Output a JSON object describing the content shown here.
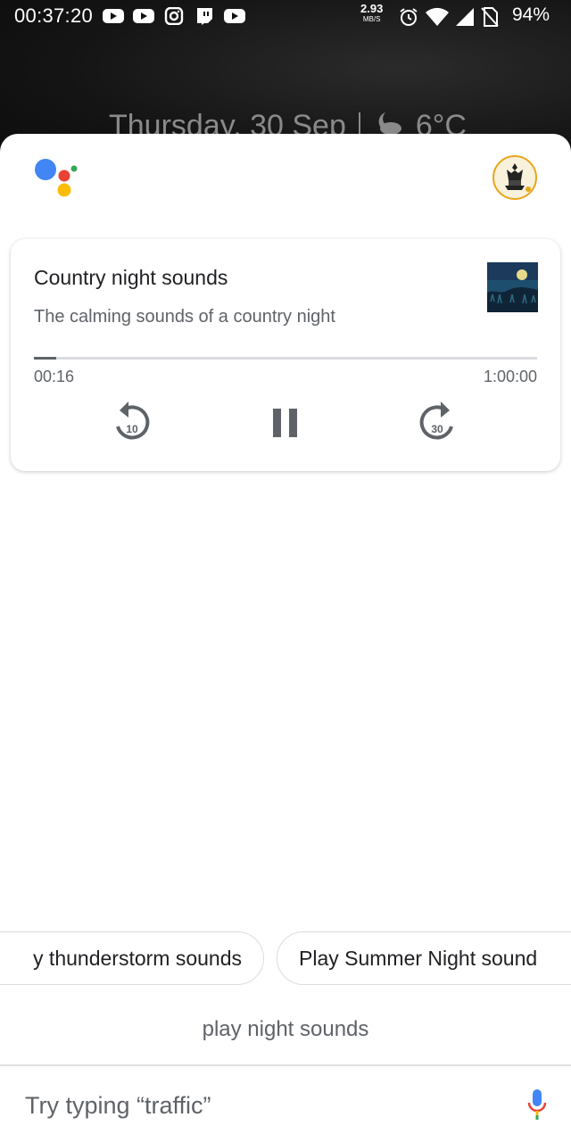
{
  "status_bar": {
    "time": "00:37:20",
    "net_speed_value": "2.93",
    "net_speed_unit": "MB/S",
    "battery": "94%",
    "app_icons": [
      "youtube-icon",
      "youtube-icon",
      "instagram-icon",
      "twitch-icon",
      "youtube-icon"
    ],
    "system_icons": [
      "alarm-icon",
      "wifi-icon",
      "signal-icon",
      "no-sim-icon"
    ]
  },
  "lockscreen": {
    "date": "Thursday, 30 Sep",
    "temperature": "6°C",
    "weather_icon": "moon-cloud-icon"
  },
  "assistant": {
    "logo_icon": "google-assistant-logo",
    "avatar_icon": "profile-avatar"
  },
  "media_card": {
    "title": "Country night sounds",
    "subtitle": "The calming sounds of a country night",
    "elapsed": "00:16",
    "total": "1:00:00",
    "progress_fraction": 0.0044,
    "rewind_seconds": "10",
    "forward_seconds": "30",
    "thumbnail_icon": "night-field-thumbnail"
  },
  "suggestions": {
    "chips": [
      "y thunderstorm sounds",
      "Play Summer Night sound"
    ]
  },
  "query": "play night sounds",
  "input": {
    "placeholder": "Try typing “traffic”",
    "mic_icon": "mic-icon"
  },
  "colors": {
    "google_blue": "#4285F4",
    "google_red": "#EA4335",
    "google_yellow": "#FBBC05",
    "google_green": "#34A853"
  }
}
